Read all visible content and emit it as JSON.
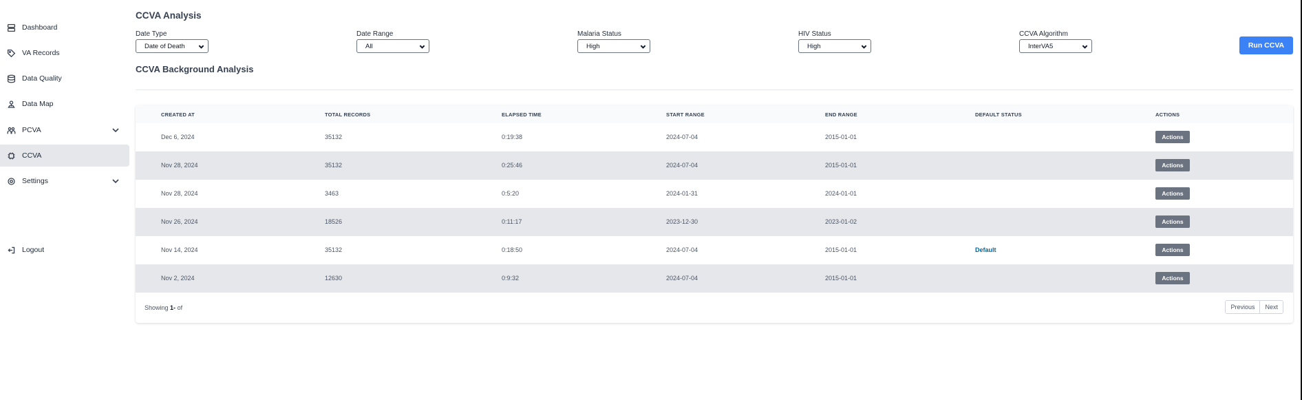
{
  "sidebar": {
    "items": [
      {
        "label": "Dashboard",
        "icon": "dashboard-icon",
        "active": false
      },
      {
        "label": "VA Records",
        "icon": "tag-icon",
        "active": false
      },
      {
        "label": "Data Quality",
        "icon": "database-icon",
        "active": false
      },
      {
        "label": "Data Map",
        "icon": "map-pin-icon",
        "active": false
      },
      {
        "label": "PCVA",
        "icon": "users-icon",
        "active": false,
        "expandable": true
      },
      {
        "label": "CCVA",
        "icon": "chip-icon",
        "active": true
      },
      {
        "label": "Settings",
        "icon": "gear-icon",
        "active": false,
        "expandable": true
      }
    ],
    "logout_label": "Logout"
  },
  "page": {
    "title": "CCVA Analysis",
    "filters": [
      {
        "label": "Date Type",
        "value": "Date of Death"
      },
      {
        "label": "Date Range",
        "value": "All"
      },
      {
        "label": "Malaria Status",
        "value": "High"
      },
      {
        "label": "HIV Status",
        "value": "High"
      },
      {
        "label": "CCVA Algorithm",
        "value": "InterVA5"
      }
    ],
    "run_button": "Run CCVA",
    "section_title": "CCVA Background Analysis"
  },
  "table": {
    "headers": [
      "CREATED AT",
      "TOTAL RECORDS",
      "ELAPSED TIME",
      "START RANGE",
      "END RANGE",
      "DEFAULT STATUS",
      "ACTIONS"
    ],
    "rows": [
      {
        "created_at": "Dec 6, 2024",
        "total_records": "35132",
        "elapsed_time": "0:19:38",
        "start_range": "2024-07-04",
        "end_range": "2015-01-01",
        "default_status": "",
        "action": "Actions"
      },
      {
        "created_at": "Nov 28, 2024",
        "total_records": "35132",
        "elapsed_time": "0:25:46",
        "start_range": "2024-07-04",
        "end_range": "2015-01-01",
        "default_status": "",
        "action": "Actions"
      },
      {
        "created_at": "Nov 28, 2024",
        "total_records": "3463",
        "elapsed_time": "0:5:20",
        "start_range": "2024-01-31",
        "end_range": "2024-01-01",
        "default_status": "",
        "action": "Actions"
      },
      {
        "created_at": "Nov 26, 2024",
        "total_records": "18526",
        "elapsed_time": "0:11:17",
        "start_range": "2023-12-30",
        "end_range": "2023-01-02",
        "default_status": "",
        "action": "Actions"
      },
      {
        "created_at": "Nov 14, 2024",
        "total_records": "35132",
        "elapsed_time": "0:18:50",
        "start_range": "2024-07-04",
        "end_range": "2015-01-01",
        "default_status": "Default",
        "action": "Actions"
      },
      {
        "created_at": "Nov 2, 2024",
        "total_records": "12630",
        "elapsed_time": "0:9:32",
        "start_range": "2024-07-04",
        "end_range": "2015-01-01",
        "default_status": "",
        "action": "Actions"
      }
    ],
    "footer": {
      "showing_prefix": "Showing",
      "range": "1-",
      "of_text": "of"
    },
    "pagination": {
      "previous": "Previous",
      "next": "Next"
    }
  },
  "colors": {
    "primary": "#3b82f6",
    "active_nav": "#e5e7eb",
    "row_alt": "#e5e7eb",
    "action_button": "#6b7280",
    "default_text": "#0369a1"
  }
}
